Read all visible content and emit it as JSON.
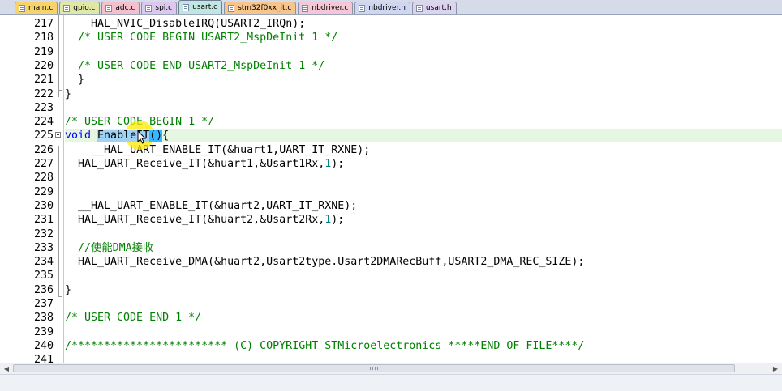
{
  "tabs": [
    {
      "label": "main.c",
      "color": "#f6d46a",
      "active": false
    },
    {
      "label": "gpio.c",
      "color": "#dfe8a4",
      "active": false
    },
    {
      "label": "adc.c",
      "color": "#f4c0cc",
      "active": false
    },
    {
      "label": "spi.c",
      "color": "#dcc8ee",
      "active": false
    },
    {
      "label": "usart.c",
      "color": "#bfe6e2",
      "active": true
    },
    {
      "label": "stm32f0xx_it.c",
      "color": "#f7c48c",
      "active": false
    },
    {
      "label": "nbdriver.c",
      "color": "#f5c6d6",
      "active": false
    },
    {
      "label": "nbdriver.h",
      "color": "#cfd6f2",
      "active": false
    },
    {
      "label": "usart.h",
      "color": "#dcd4ef",
      "active": false
    }
  ],
  "colors": {
    "comment": "#008000",
    "keyword": "#0000ff",
    "number": "#008080",
    "current_line": "#e5f7e1",
    "selection": "#9fd2f5"
  },
  "lines": [
    {
      "n": "217",
      "indent": "    ",
      "text": "HAL_NVIC_DisableIRQ(USART2_IRQn);"
    },
    {
      "n": "218",
      "indent": "  ",
      "text": "/* USER CODE BEGIN USART2_MspDeInit 1 */"
    },
    {
      "n": "219",
      "indent": "",
      "text": ""
    },
    {
      "n": "220",
      "indent": "  ",
      "text": "/* USER CODE END USART2_MspDeInit 1 */"
    },
    {
      "n": "221",
      "indent": "  ",
      "text": "}"
    },
    {
      "n": "222",
      "indent": "",
      "text": "}"
    },
    {
      "n": "223",
      "indent": "",
      "text": ""
    },
    {
      "n": "224",
      "indent": "",
      "text": "/* USER CODE BEGIN 1 */"
    },
    {
      "n": "225",
      "keyword": "void",
      "sel": "EnableIT",
      "paren": "()",
      "rest": "{"
    },
    {
      "n": "226",
      "indent": "    ",
      "text": "__HAL_UART_ENABLE_IT(&huart1,UART_IT_RXNE);"
    },
    {
      "n": "227",
      "indent": "  ",
      "pre": "HAL_UART_Receive_IT(&huart1,&Usart1Rx,",
      "num": "1",
      "post": ");"
    },
    {
      "n": "228",
      "indent": "",
      "text": ""
    },
    {
      "n": "229",
      "indent": "",
      "text": ""
    },
    {
      "n": "230",
      "indent": "  ",
      "text": "__HAL_UART_ENABLE_IT(&huart2,UART_IT_RXNE);"
    },
    {
      "n": "231",
      "indent": "  ",
      "pre": "HAL_UART_Receive_IT(&huart2,&Usart2Rx,",
      "num": "1",
      "post": ");"
    },
    {
      "n": "232",
      "indent": "",
      "text": ""
    },
    {
      "n": "233",
      "indent": "  ",
      "text": "//使能DMA接收"
    },
    {
      "n": "234",
      "indent": "  ",
      "text": "HAL_UART_Receive_DMA(&huart2,Usart2type.Usart2DMARecBuff,USART2_DMA_REC_SIZE);"
    },
    {
      "n": "235",
      "indent": "",
      "text": ""
    },
    {
      "n": "236",
      "indent": "",
      "text": "}"
    },
    {
      "n": "237",
      "indent": "",
      "text": ""
    },
    {
      "n": "238",
      "indent": "",
      "text": "/* USER CODE END 1 */"
    },
    {
      "n": "239",
      "indent": "",
      "text": ""
    },
    {
      "n": "240",
      "indent": "",
      "text": "/************************ (C) COPYRIGHT STMicroelectronics *****END OF FILE****/"
    },
    {
      "n": "241",
      "indent": "",
      "text": ""
    }
  ]
}
